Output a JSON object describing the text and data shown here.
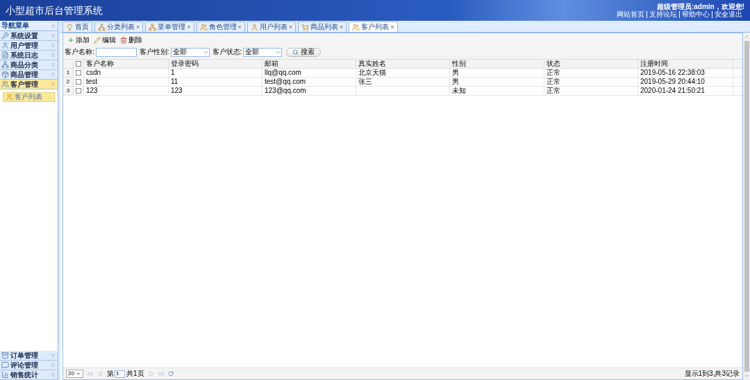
{
  "header": {
    "title": "小型超市后台管理系统",
    "greeting": "超级管理员:admin，欢迎您!",
    "links": [
      "网站首页",
      "支持论坛",
      "帮助中心",
      "安全退出"
    ]
  },
  "sidebar": {
    "title": "导航菜单",
    "sections": [
      {
        "label": "系统设置",
        "kind": "tools",
        "expanded": false
      },
      {
        "label": "用户管理",
        "kind": "user",
        "expanded": false
      },
      {
        "label": "系统日志",
        "kind": "log",
        "expanded": false
      },
      {
        "label": "商品分类",
        "kind": "tree",
        "expanded": false
      },
      {
        "label": "商品管理",
        "kind": "box",
        "expanded": false
      },
      {
        "label": "客户管理",
        "kind": "users",
        "expanded": true,
        "children": [
          {
            "label": "客户列表",
            "selected": true
          }
        ]
      },
      {
        "label": "订单管理",
        "kind": "order",
        "expanded": false
      },
      {
        "label": "评论管理",
        "kind": "comment",
        "expanded": false
      },
      {
        "label": "销售统计",
        "kind": "chart",
        "expanded": false
      }
    ]
  },
  "tabs": [
    {
      "label": "首页",
      "kind": "bulb",
      "selected": false
    },
    {
      "label": "分类列表",
      "kind": "tree",
      "close": "×",
      "selected": false
    },
    {
      "label": "菜单管理",
      "kind": "tree",
      "close": "×",
      "selected": false
    },
    {
      "label": "角色管理",
      "kind": "users",
      "close": "×",
      "selected": false
    },
    {
      "label": "用户列表",
      "kind": "user",
      "close": "×",
      "selected": false
    },
    {
      "label": "商品列表",
      "kind": "cart",
      "close": "×",
      "selected": false
    },
    {
      "label": "客户列表",
      "kind": "users",
      "close": "×",
      "selected": true
    }
  ],
  "toolbar": [
    {
      "label": "添加",
      "kind": "add"
    },
    {
      "label": "编辑",
      "kind": "edit"
    },
    {
      "label": "删除",
      "kind": "delete"
    }
  ],
  "filters": [
    {
      "label": "客户名称:",
      "kind": "text"
    },
    {
      "label": "客户性别:",
      "kind": "select",
      "value": "全部"
    },
    {
      "label": "客户状态:",
      "kind": "select",
      "value": "全部"
    }
  ],
  "search_button": "搜索",
  "table": {
    "select_all_checked": false,
    "columns": [
      "客户名称",
      "登录密码",
      "邮箱",
      "真实姓名",
      "性别",
      "状态",
      "注册时间"
    ],
    "rows": [
      {
        "number": "1",
        "checked": false,
        "cells": [
          "csdn",
          "1",
          "llq@qq.com",
          "北京天猫",
          "男",
          "正常",
          "2019-05-16 22:38:03"
        ]
      },
      {
        "number": "2",
        "checked": false,
        "cells": [
          "test",
          "11",
          "test@qq.com",
          "张三",
          "男",
          "正常",
          "2019-05-29 20:44:10"
        ]
      },
      {
        "number": "3",
        "checked": false,
        "cells": [
          "123",
          "123",
          "123@qq.com",
          "",
          "未知",
          "正常",
          "2020-01-24 21:50:21"
        ]
      }
    ]
  },
  "pager": {
    "page_size": "20",
    "page_prefix": "第",
    "page": "1",
    "total_pages": "共1页",
    "summary": "显示1到3,共3记录"
  }
}
